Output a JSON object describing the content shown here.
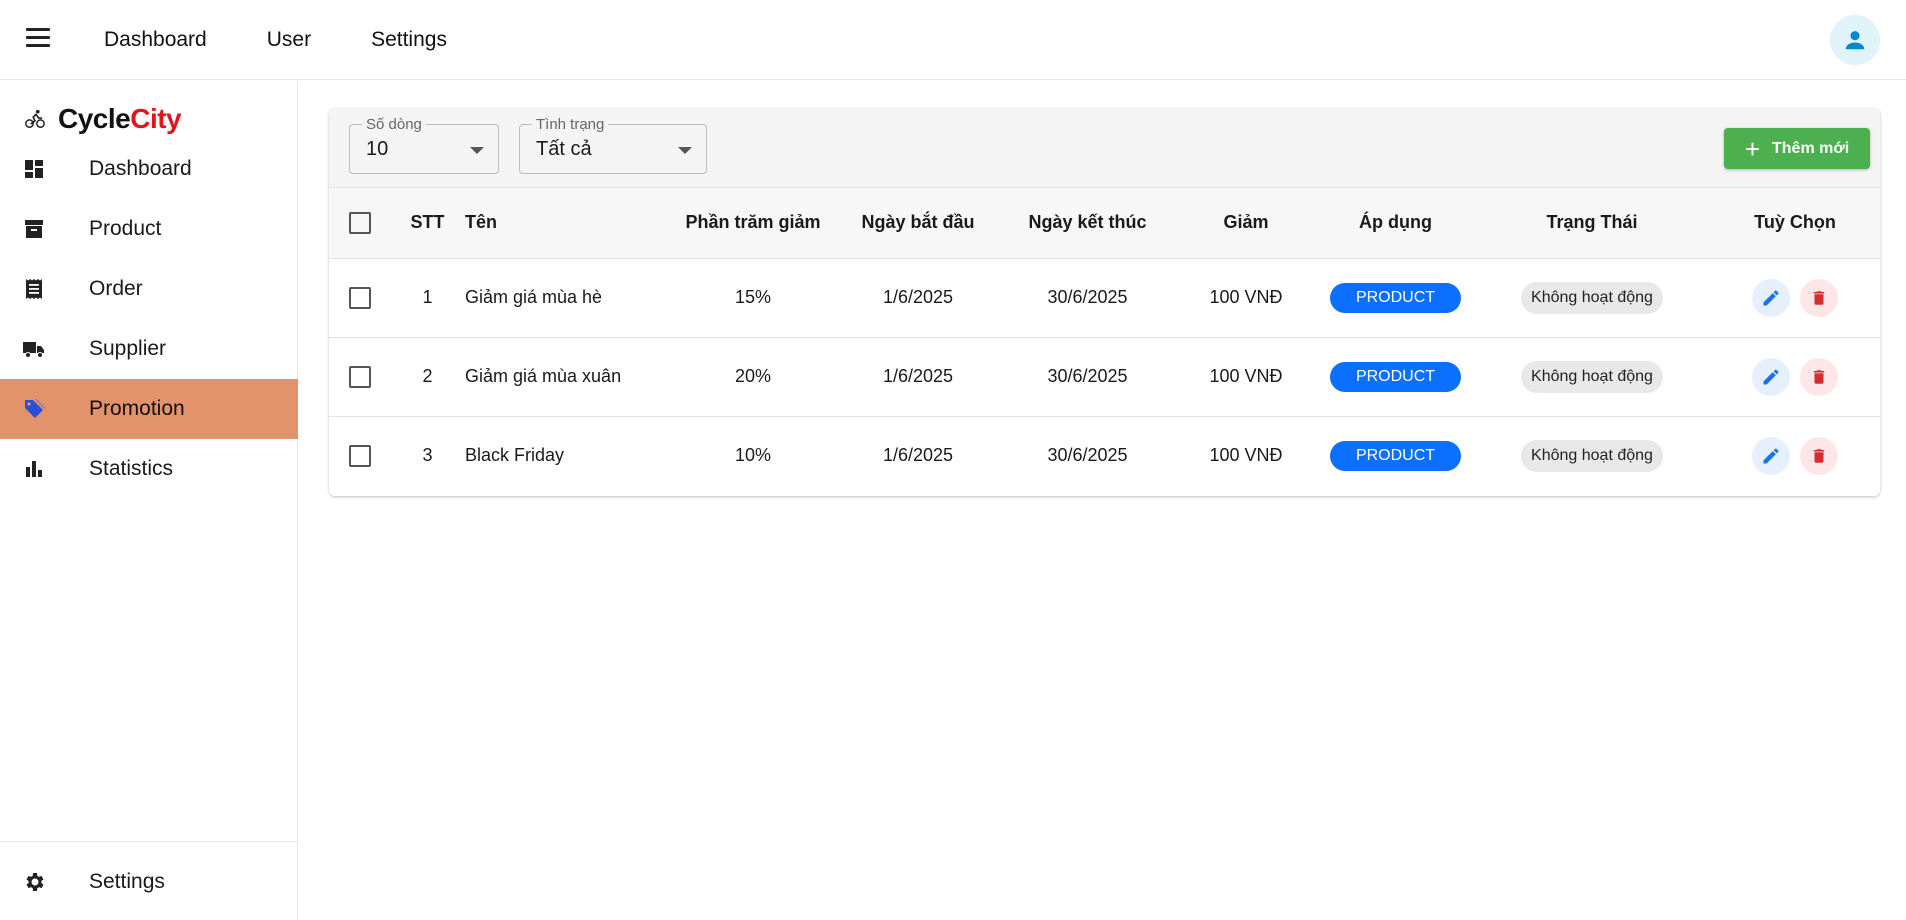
{
  "topbar": {
    "nav": [
      "Dashboard",
      "User",
      "Settings"
    ]
  },
  "sidebar": {
    "brand": {
      "part1": "Cycle",
      "part2": "City"
    },
    "items": [
      {
        "label": "Dashboard",
        "icon": "dashboard-icon"
      },
      {
        "label": "Product",
        "icon": "archive-icon"
      },
      {
        "label": "Order",
        "icon": "receipt-icon"
      },
      {
        "label": "Supplier",
        "icon": "truck-icon"
      },
      {
        "label": "Promotion",
        "icon": "tag-icon",
        "active": true
      },
      {
        "label": "Statistics",
        "icon": "bar-chart-icon"
      }
    ],
    "footer": {
      "label": "Settings",
      "icon": "gear-icon"
    }
  },
  "toolbar": {
    "rows_select": {
      "label": "Số dòng",
      "value": "10"
    },
    "status_select": {
      "label": "Tình trạng",
      "value": "Tất cả"
    },
    "add_label": "Thêm mới"
  },
  "table": {
    "headers": [
      "STT",
      "Tên",
      "Phần trăm giảm",
      "Ngày bắt đầu",
      "Ngày kết thúc",
      "Giảm",
      "Áp dụng",
      "Trạng Thái",
      "Tuỳ Chọn"
    ],
    "rows": [
      {
        "stt": "1",
        "name": "Giảm giá mùa hè",
        "percent": "15%",
        "start": "1/6/2025",
        "end": "30/6/2025",
        "discount": "100 VNĐ",
        "apply": "PRODUCT",
        "status": "Không hoạt động"
      },
      {
        "stt": "2",
        "name": "Giảm giá mùa xuân",
        "percent": "20%",
        "start": "1/6/2025",
        "end": "30/6/2025",
        "discount": "100 VNĐ",
        "apply": "PRODUCT",
        "status": "Không hoạt động"
      },
      {
        "stt": "3",
        "name": "Black Friday",
        "percent": "10%",
        "start": "1/6/2025",
        "end": "30/6/2025",
        "discount": "100 VNĐ",
        "apply": "PRODUCT",
        "status": "Không hoạt động"
      }
    ]
  },
  "colors": {
    "active_nav": "#e3936b",
    "brand_accent": "#e4141b",
    "add_button": "#4caf50",
    "chip_product": "#0b6fff",
    "edit_icon": "#1a73e8",
    "delete_icon": "#d32f2f"
  }
}
